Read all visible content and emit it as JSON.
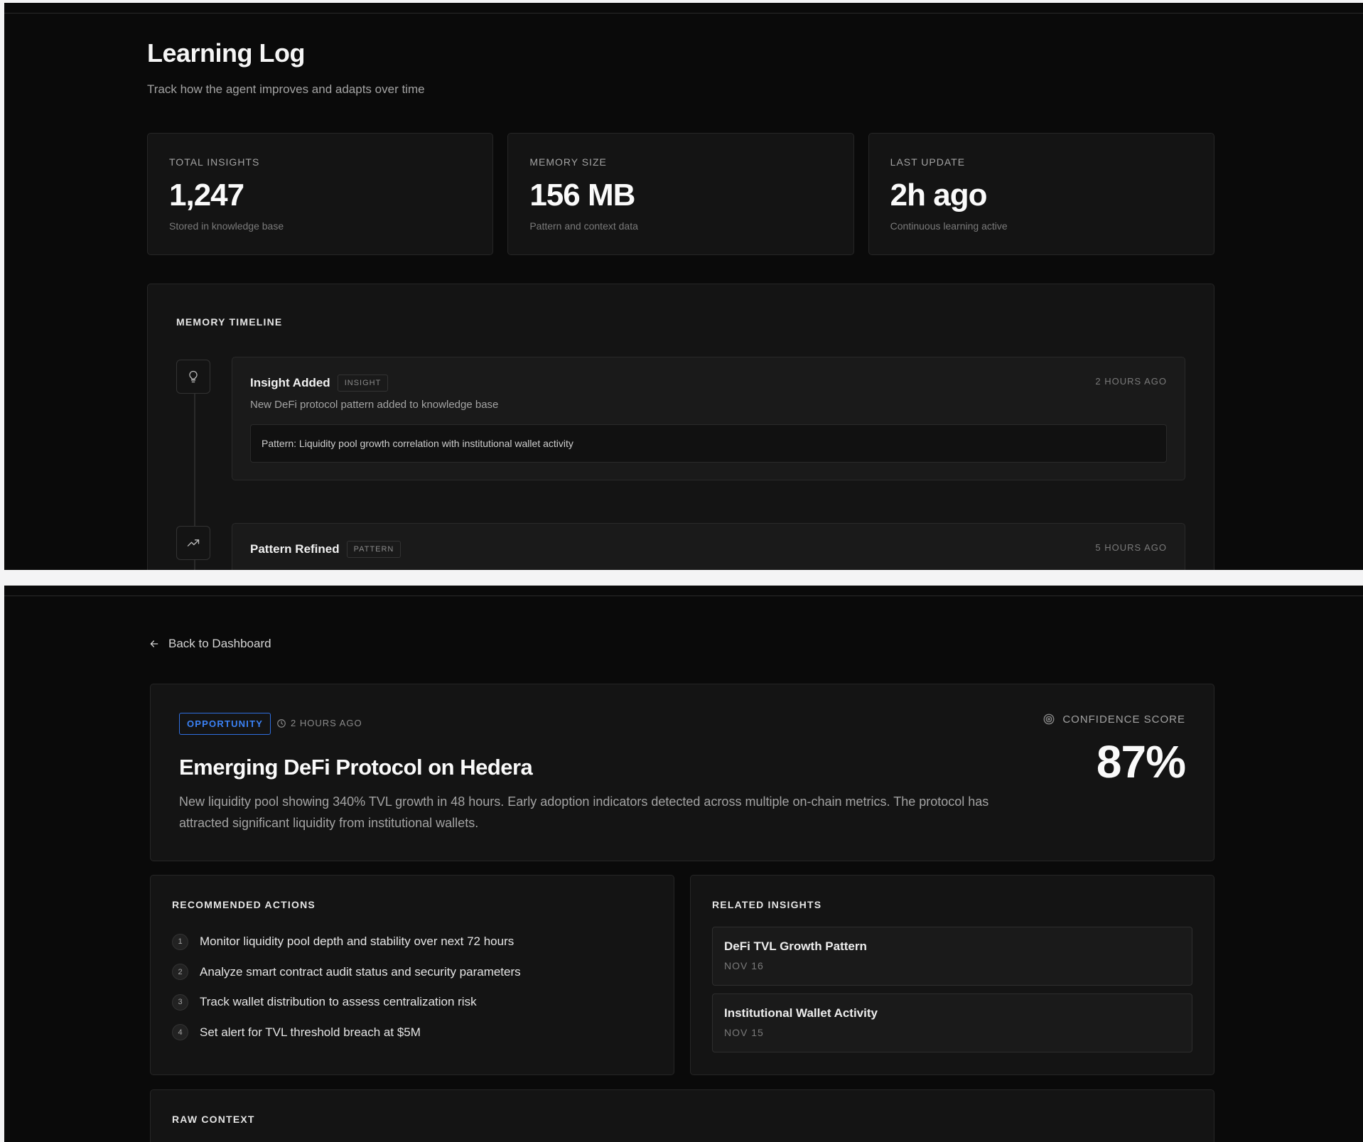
{
  "learning_log": {
    "title": "Learning Log",
    "subtitle": "Track how the agent improves and adapts over time",
    "stats": [
      {
        "label": "Total Insights",
        "value": "1,247",
        "sub": "Stored in knowledge base"
      },
      {
        "label": "Memory Size",
        "value": "156 MB",
        "sub": "Pattern and context data"
      },
      {
        "label": "Last Update",
        "value": "2h ago",
        "sub": "Continuous learning active"
      }
    ],
    "timeline": {
      "label": "Memory Timeline",
      "entries": [
        {
          "icon": "lightbulb-icon",
          "title": "Insight Added",
          "tag": "Insight",
          "time": "2 hours ago",
          "description": "New DeFi protocol pattern added to knowledge base",
          "detail": "Pattern: Liquidity pool growth correlation with institutional wallet activity"
        },
        {
          "icon": "trending-up-icon",
          "title": "Pattern Refined",
          "tag": "Pattern",
          "time": "5 hours ago"
        }
      ]
    }
  },
  "insight_detail": {
    "back_label": "Back to Dashboard",
    "badge": "Opportunity",
    "time": "2 hours ago",
    "title": "Emerging DeFi Protocol on Hedera",
    "description": "New liquidity pool showing 340% TVL growth in 48 hours. Early adoption indicators detected across multiple on-chain metrics. The protocol has attracted significant liquidity from institutional wallets.",
    "confidence_label": "Confidence Score",
    "confidence_value": "87%",
    "accent_color": "#3b82f6",
    "recommended_actions": {
      "label": "Recommended Actions",
      "items": [
        {
          "num": "1",
          "text": "Monitor liquidity pool depth and stability over next 72 hours"
        },
        {
          "num": "2",
          "text": "Analyze smart contract audit status and security parameters"
        },
        {
          "num": "3",
          "text": "Track wallet distribution to assess centralization risk"
        },
        {
          "num": "4",
          "text": "Set alert for TVL threshold breach at $5M"
        }
      ]
    },
    "related_insights": {
      "label": "Related Insights",
      "items": [
        {
          "title": "DeFi TVL Growth Pattern",
          "date": "Nov 16"
        },
        {
          "title": "Institutional Wallet Activity",
          "date": "Nov 15"
        }
      ]
    },
    "raw_context": {
      "label": "Raw Context"
    }
  }
}
